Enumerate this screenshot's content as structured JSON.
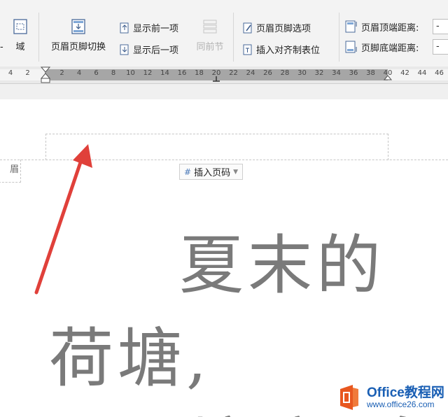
{
  "ribbon": {
    "field_label": "域",
    "header_footer_switch": "页眉页脚切换",
    "show_previous": "显示前一项",
    "show_next": "显示后一项",
    "same_as_previous": "同前节",
    "header_footer_options": "页眉页脚选项",
    "insert_align_tab": "插入对齐制表位",
    "header_top_distance": "页眉顶端距离:",
    "footer_bottom_distance": "页脚底端距离:",
    "spin_value_top": "-",
    "spin_value_bottom": "-",
    "left_cut": "-"
  },
  "ruler": {
    "ticks": [
      "4",
      "2",
      "2",
      "4",
      "6",
      "8",
      "10",
      "12",
      "14",
      "16",
      "18",
      "20",
      "22",
      "24",
      "26",
      "28",
      "30",
      "32",
      "34",
      "36",
      "38",
      "40",
      "42",
      "44",
      "46"
    ]
  },
  "document": {
    "header_tag": "眉",
    "insert_page_number": "插入页码",
    "line1": "夏末的",
    "line2": "荷塘,",
    "line3": "塘 新 名"
  },
  "watermark": {
    "brand": "Office教程网",
    "url": "www.office26.com"
  },
  "colors": {
    "arrow": "#e0403a",
    "accent": "#1a5fb4",
    "logo": "#e8571f"
  },
  "icons": [
    "field-icon",
    "header-footer-switch-icon",
    "show-previous-icon",
    "show-next-icon",
    "same-as-previous-icon",
    "options-icon",
    "align-tab-icon",
    "header-top-icon",
    "footer-bottom-icon"
  ]
}
